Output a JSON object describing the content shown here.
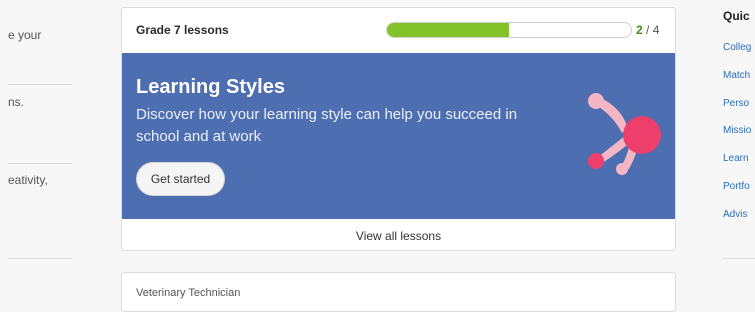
{
  "left_column": {
    "snippets": [
      "e your",
      "ns.",
      "eativity,"
    ]
  },
  "lesson_card": {
    "title": "Grade 7 lessons",
    "progress": {
      "completed": 2,
      "total": 4,
      "completed_text": "2",
      "separator_total_text": "/ 4",
      "fill_color": "#84c22a"
    },
    "banner": {
      "title": "Learning Styles",
      "description": "Discover how your learning style can help you succeed in school and at work",
      "button_label": "Get started",
      "background_color": "#4d6eb0"
    },
    "footer_label": "View all lessons"
  },
  "next_card": {
    "title": "Veterinary Technician"
  },
  "quick_links": {
    "heading": "Quic",
    "items": [
      "Colleg",
      "Match",
      "Perso",
      "Missio",
      "Learn",
      "Portfo",
      "Advis"
    ],
    "link_color": "#2a6ebb"
  }
}
